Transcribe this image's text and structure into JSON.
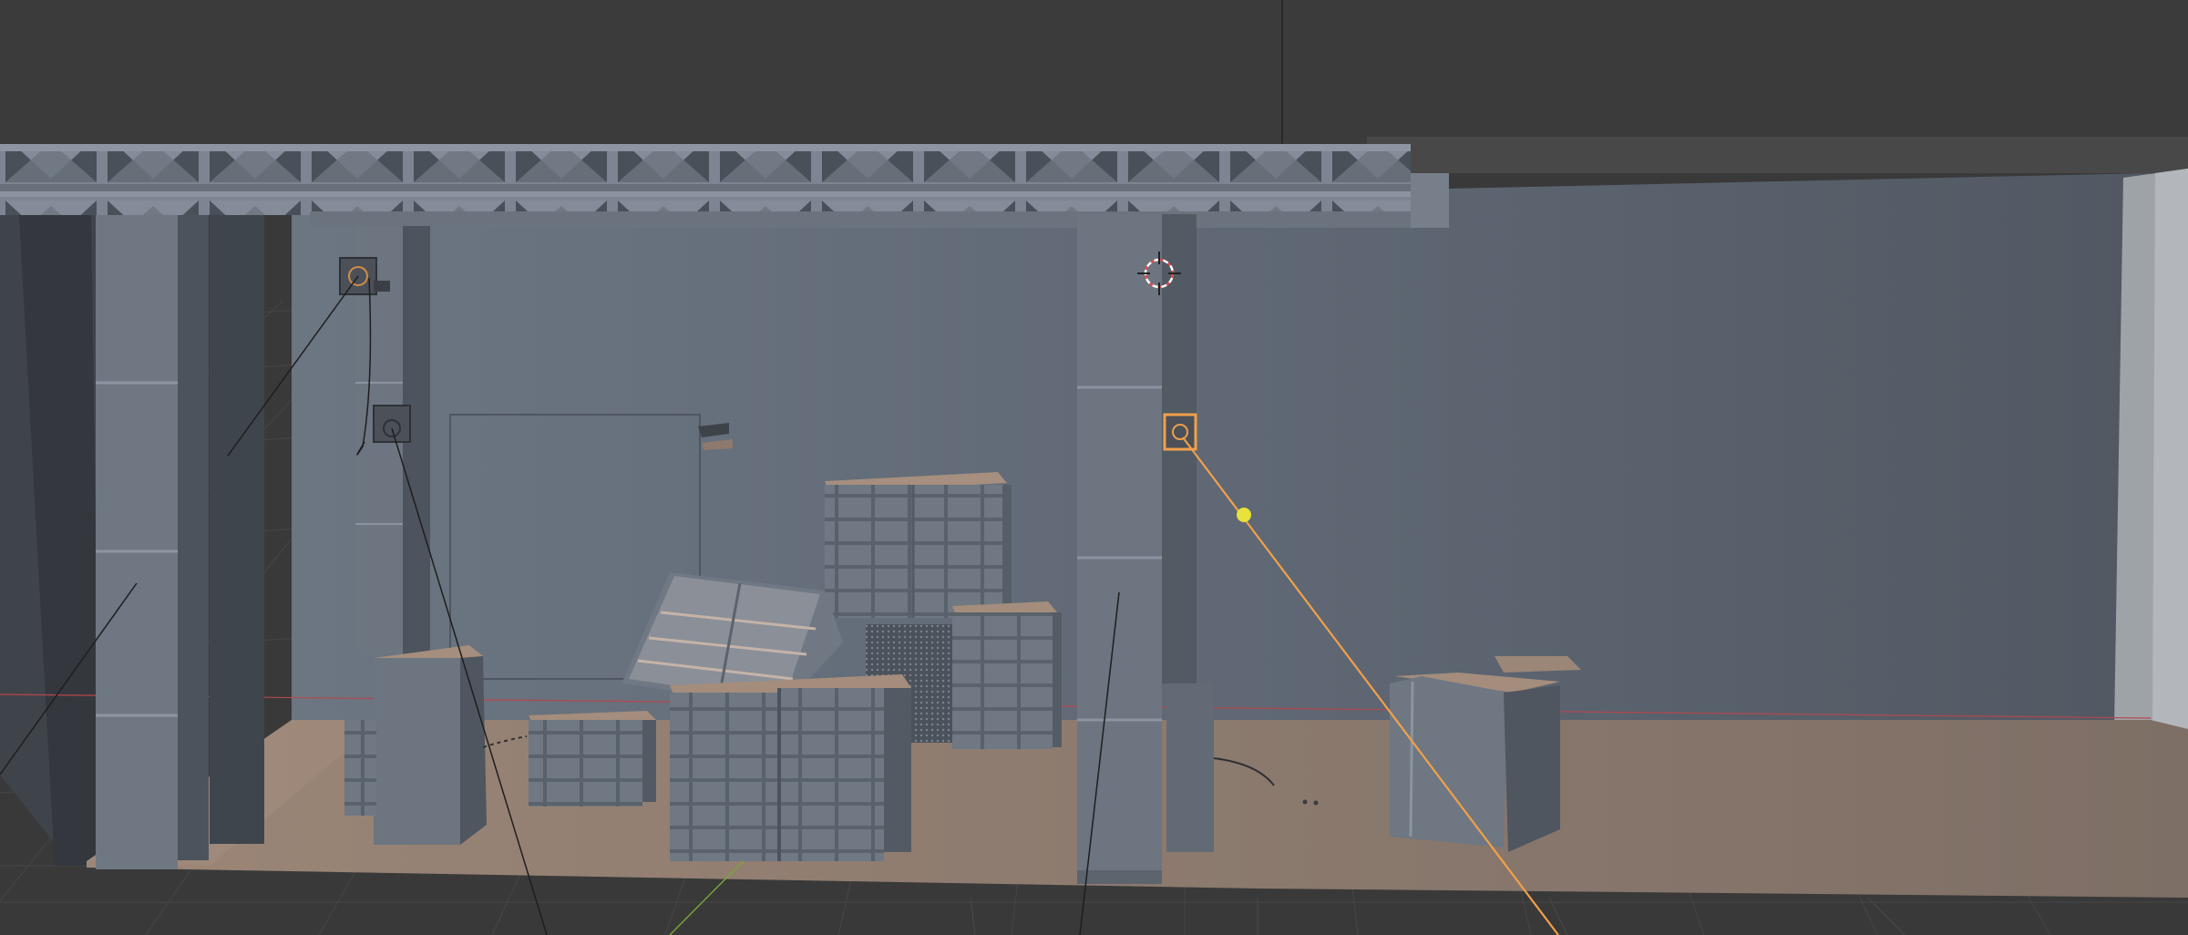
{
  "viewport": {
    "background": "#393939",
    "grid_color": "#444444",
    "x_axis_color": "#b4474d",
    "y_axis_color": "#7aa63a"
  },
  "scene": {
    "back_wall_color": "#5f6874",
    "floor_color": "#8c7a6e",
    "truss_color": "#7a838f",
    "column_color": "#6f7883",
    "crate_color": "#707984",
    "crate_top_color": "#a48d7c",
    "selection_color": "#f0a04a",
    "light_target_color": "#e8e23a",
    "cursor_color": "#e24c4c"
  },
  "icons": {
    "cursor": "3d-cursor-icon",
    "light": "spot-light-icon",
    "light_target": "light-target-icon"
  }
}
